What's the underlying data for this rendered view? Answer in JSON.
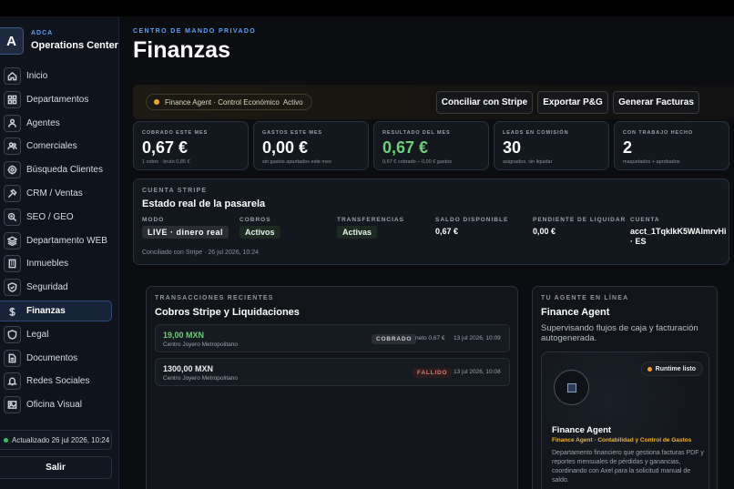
{
  "sidebar": {
    "brand": {
      "logo_letter": "A",
      "tag": "ADCA",
      "name": "Operations Center"
    },
    "items": [
      {
        "label": "Inicio",
        "icon": "home-icon"
      },
      {
        "label": "Departamentos",
        "icon": "grid-icon"
      },
      {
        "label": "Agentes",
        "icon": "agents-icon"
      },
      {
        "label": "Comerciales",
        "icon": "users-icon"
      },
      {
        "label": "Búsqueda Clientes",
        "icon": "target-icon"
      },
      {
        "label": "CRM / Ventas",
        "icon": "crm-icon"
      },
      {
        "label": "SEO / GEO",
        "icon": "search-icon"
      },
      {
        "label": "Departamento WEB",
        "icon": "layers-icon"
      },
      {
        "label": "Inmuebles",
        "icon": "building-icon"
      },
      {
        "label": "Seguridad",
        "icon": "shield-icon"
      },
      {
        "label": "Finanzas",
        "icon": "dollar-icon",
        "active": true
      },
      {
        "label": "Legal",
        "icon": "legal-shield-icon"
      },
      {
        "label": "Documentos",
        "icon": "document-icon"
      },
      {
        "label": "Redes Sociales",
        "icon": "bell-icon"
      },
      {
        "label": "Oficina Visual",
        "icon": "image-icon"
      }
    ],
    "updated": "Actualizado 26 jul 2026, 10:24",
    "logout": "Salir"
  },
  "header": {
    "eyebrow": "CENTRO DE MANDO PRIVADO",
    "title": "Finanzas"
  },
  "agentbar": {
    "agent": "Finance Agent · Control Económico",
    "status": "Activo",
    "buttons": [
      "Conciliar con Stripe",
      "Exportar P&G",
      "Generar Facturas"
    ]
  },
  "kpis": [
    {
      "label": "COBRADO ESTE MES",
      "value": "0,67 €",
      "sub": "1 cobro · bruto 0,85 €"
    },
    {
      "label": "GASTOS ESTE MES",
      "value": "0,00 €",
      "sub": "sin gastos apuntados este mes"
    },
    {
      "label": "RESULTADO DEL MES",
      "value": "0,67 €",
      "sub": "0,67 € cobrado − 0,00 € gastos"
    },
    {
      "label": "LEADS EN COMISIÓN",
      "value": "30",
      "sub": "asignados, sin liquidar"
    },
    {
      "label": "CON TRABAJO HECHO",
      "value": "2",
      "sub": "maquetados + aprobados"
    }
  ],
  "stripe": {
    "tag": "CUENTA STRIPE",
    "title": "Estado real de la pasarela",
    "modo_label": "MODO",
    "modo_value": "LIVE · dinero real",
    "cobros_label": "COBROS",
    "cobros_value": "Activos",
    "transfer_label": "TRANSFERENCIAS",
    "transfer_value": "Activas",
    "saldo_label": "SALDO DISPONIBLE",
    "saldo_value": "0,67 €",
    "pendiente_label": "PENDIENTE DE LIQUIDAR",
    "pendiente_value": "0,00 €",
    "cuenta_label": "CUENTA",
    "cuenta_value": "acct_1TqkIkK5WAlmrvHi · ES",
    "footer": "Conciliado con Stripe · 26 jul 2026, 10:24"
  },
  "transactions": {
    "tag": "TRANSACCIONES RECIENTES",
    "title": "Cobros Stripe y Liquidaciones",
    "rows": [
      {
        "amount": "19,00 MXN",
        "client": "Centro Joyero Metropolitano",
        "status": "COBRADO",
        "net": "neto 0,67 €",
        "date": "13 jul 2026, 10:09"
      },
      {
        "amount": "1300,00 MXN",
        "client": "Centro Joyero Metropolitano",
        "status": "FALLIDO",
        "net": "",
        "date": "13 jul 2026, 10:08"
      }
    ]
  },
  "agent": {
    "tag": "TU AGENTE EN LÍNEA",
    "title": "Finance Agent",
    "desc": "Supervisando flujos de caja y facturación autogenerada.",
    "runtime": "Runtime listo",
    "name": "Finance Agent",
    "role": "Finance Agent · Contabilidad y Control de Gastos",
    "bio": "Departamento financiero que gestiona facturas PDF y reportes mensuales de pérdidas y ganancias, coordinando con Axel para la solicitud manual de saldo."
  },
  "colors": {
    "accent": "#5aa0ff",
    "positive": "#6ccf7a",
    "status_ok": "#38c172",
    "status_warn": "#f0a429",
    "failed": "#e07a7a"
  }
}
